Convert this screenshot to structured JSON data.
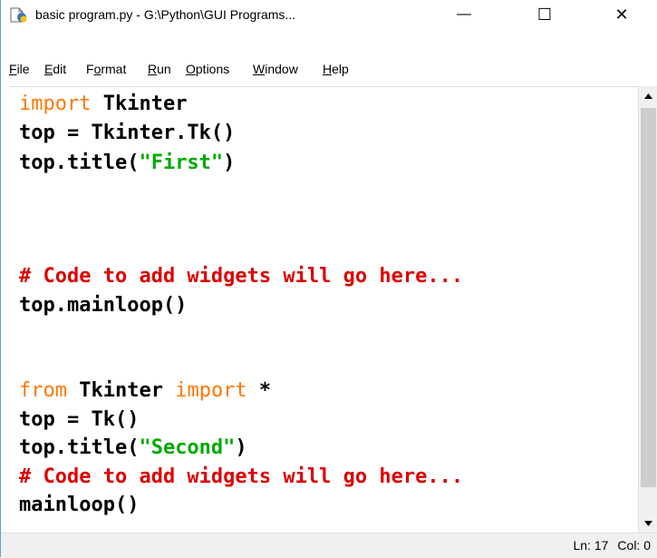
{
  "window": {
    "title": "basic program.py - G:\\Python\\GUI Programs...",
    "minimize_glyph": "—",
    "maximize_glyph": "☐",
    "close_glyph": "✕"
  },
  "menu": {
    "items": [
      {
        "first": "F",
        "rest": "ile"
      },
      {
        "first": "E",
        "rest": "dit"
      },
      {
        "pre": "F",
        "first": "o",
        "rest": "rmat"
      },
      {
        "first": "R",
        "rest": "un"
      },
      {
        "first": "O",
        "rest": "ptions"
      },
      {
        "first": "W",
        "rest": "indow"
      },
      {
        "first": "H",
        "rest": "elp"
      }
    ]
  },
  "code": {
    "l1_kw": "import",
    "l1_rest": " Tkinter",
    "l2": "top = Tkinter.Tk()",
    "l3_a": "top.title(",
    "l3_str": "\"First\"",
    "l3_b": ")",
    "l7": "# Code to add widgets will go here...",
    "l8": "top.mainloop()",
    "l11_kw1": "from",
    "l11_mid": " Tkinter ",
    "l11_kw2": "import",
    "l11_end": " *",
    "l12": "top = Tk()",
    "l13_a": "top.title(",
    "l13_str": "\"Second\"",
    "l13_b": ")",
    "l14": "# Code to add widgets will go here...",
    "l15": "mainloop()"
  },
  "status": {
    "line": "Ln: 17",
    "col": "Col: 0"
  },
  "colors": {
    "keyword": "#ff7700",
    "string": "#00aa00",
    "comment": "#dd0000"
  },
  "icons": {
    "app": "idle-python-file-icon",
    "scroll_up": "triangle-up",
    "scroll_down": "triangle-down"
  }
}
